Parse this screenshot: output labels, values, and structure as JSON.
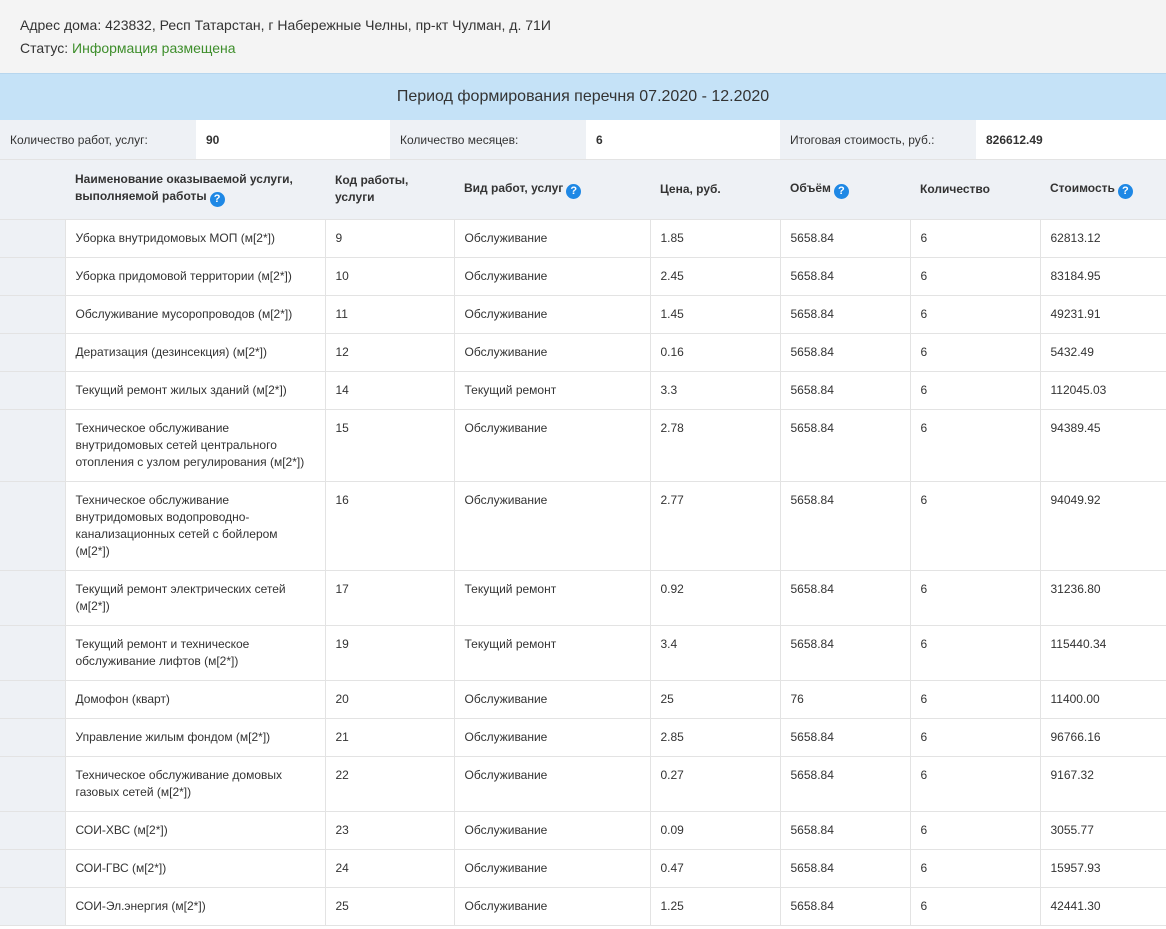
{
  "address": {
    "label": "Адрес дома:",
    "value": "423832, Респ Татарстан, г Набережные Челны, пр-кт Чулман, д. 71И"
  },
  "status": {
    "label": "Статус:",
    "value": "Информация размещена",
    "color": "#3e8e2b"
  },
  "period": "Период формирования перечня 07.2020 - 12.2020",
  "summary": {
    "works_label": "Количество работ, услуг:",
    "works_value": "90",
    "months_label": "Количество месяцев:",
    "months_value": "6",
    "total_label": "Итоговая стоимость, руб.:",
    "total_value": "826612.49"
  },
  "columns": {
    "name": "Наименование оказываемой услуги, выполняемой работы",
    "code": "Код работы, услуги",
    "type": "Вид работ, услуг",
    "price": "Цена, руб.",
    "volume": "Объём",
    "quantity": "Количество",
    "cost": "Стоимость",
    "help_glyph": "?"
  },
  "colors": {
    "accent": "#1e88e5",
    "period_bg": "#c5e2f7"
  },
  "rows": [
    {
      "name": "Уборка внутридомовых МОП (м[2*])",
      "code": "9",
      "type": "Обслуживание",
      "price": "1.85",
      "volume": "5658.84",
      "quantity": "6",
      "cost": "62813.12"
    },
    {
      "name": "Уборка придомовой территории (м[2*])",
      "code": "10",
      "type": "Обслуживание",
      "price": "2.45",
      "volume": "5658.84",
      "quantity": "6",
      "cost": "83184.95"
    },
    {
      "name": "Обслуживание мусоропроводов (м[2*])",
      "code": "11",
      "type": "Обслуживание",
      "price": "1.45",
      "volume": "5658.84",
      "quantity": "6",
      "cost": "49231.91"
    },
    {
      "name": "Дератизация (дезинсекция) (м[2*])",
      "code": "12",
      "type": "Обслуживание",
      "price": "0.16",
      "volume": "5658.84",
      "quantity": "6",
      "cost": "5432.49"
    },
    {
      "name": "Текущий ремонт жилых зданий (м[2*])",
      "code": "14",
      "type": "Текущий ремонт",
      "price": "3.3",
      "volume": "5658.84",
      "quantity": "6",
      "cost": "112045.03"
    },
    {
      "name": "Техническое обслуживание внутридомовых сетей центрального отопления с узлом регулирования (м[2*])",
      "code": "15",
      "type": "Обслуживание",
      "price": "2.78",
      "volume": "5658.84",
      "quantity": "6",
      "cost": "94389.45"
    },
    {
      "name": "Техническое обслуживание внутридомовых водопроводно-канализационных сетей с бойлером (м[2*])",
      "code": "16",
      "type": "Обслуживание",
      "price": "2.77",
      "volume": "5658.84",
      "quantity": "6",
      "cost": "94049.92"
    },
    {
      "name": "Текущий ремонт электрических сетей (м[2*])",
      "code": "17",
      "type": "Текущий ремонт",
      "price": "0.92",
      "volume": "5658.84",
      "quantity": "6",
      "cost": "31236.80"
    },
    {
      "name": "Текущий ремонт и техническое обслуживание лифтов (м[2*])",
      "code": "19",
      "type": "Текущий ремонт",
      "price": "3.4",
      "volume": "5658.84",
      "quantity": "6",
      "cost": "115440.34"
    },
    {
      "name": "Домофон (кварт)",
      "code": "20",
      "type": "Обслуживание",
      "price": "25",
      "volume": "76",
      "quantity": "6",
      "cost": "11400.00"
    },
    {
      "name": "Управление жилым фондом (м[2*])",
      "code": "21",
      "type": "Обслуживание",
      "price": "2.85",
      "volume": "5658.84",
      "quantity": "6",
      "cost": "96766.16"
    },
    {
      "name": "Техническое обслуживание домовых газовых сетей (м[2*])",
      "code": "22",
      "type": "Обслуживание",
      "price": "0.27",
      "volume": "5658.84",
      "quantity": "6",
      "cost": "9167.32"
    },
    {
      "name": "СОИ-ХВС (м[2*])",
      "code": "23",
      "type": "Обслуживание",
      "price": "0.09",
      "volume": "5658.84",
      "quantity": "6",
      "cost": "3055.77"
    },
    {
      "name": "СОИ-ГВС (м[2*])",
      "code": "24",
      "type": "Обслуживание",
      "price": "0.47",
      "volume": "5658.84",
      "quantity": "6",
      "cost": "15957.93"
    },
    {
      "name": "СОИ-Эл.энергия (м[2*])",
      "code": "25",
      "type": "Обслуживание",
      "price": "1.25",
      "volume": "5658.84",
      "quantity": "6",
      "cost": "42441.30"
    }
  ]
}
